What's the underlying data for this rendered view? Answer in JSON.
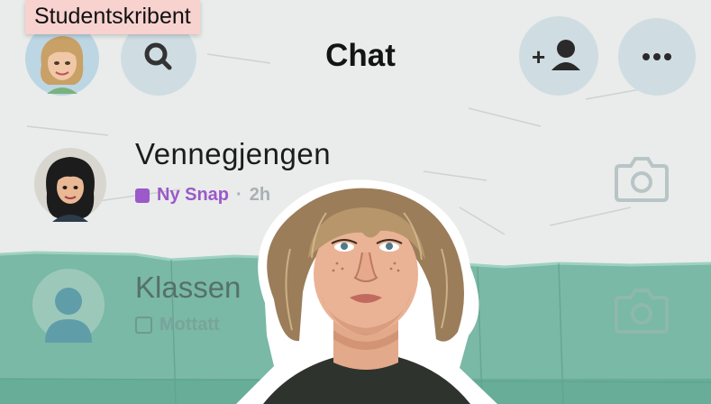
{
  "caption": "Studentskribent",
  "header": {
    "title": "Chat",
    "buttons": [
      "avatar",
      "search",
      "add-friend",
      "more"
    ]
  },
  "chats": [
    {
      "name": "Vennegjengen",
      "status": "Ny Snap",
      "separator": "·",
      "time": "2h",
      "status_color": "#9b59c9"
    },
    {
      "name": "Klassen",
      "status": "Mottatt"
    }
  ],
  "colors": {
    "background": "#e9ecea",
    "teal_overlay": "#6fb49f",
    "button": "#cfdde3",
    "caption_bg": "#f7d2cf"
  }
}
